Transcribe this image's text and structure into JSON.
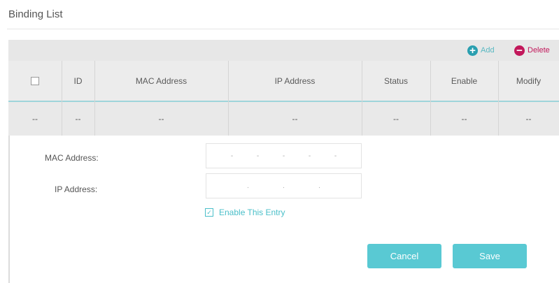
{
  "title": "Binding List",
  "toolbar": {
    "add_label": "Add",
    "delete_label": "Delete",
    "add_color": "#2a9fb0",
    "delete_color": "#c2185b",
    "add_icon": "plus-circle-icon",
    "delete_icon": "minus-circle-icon"
  },
  "table": {
    "headers": [
      "",
      "ID",
      "MAC Address",
      "IP Address",
      "Status",
      "Enable",
      "Modify"
    ],
    "rows": [
      [
        "--",
        "--",
        "--",
        "--",
        "--",
        "--",
        "--"
      ]
    ]
  },
  "form": {
    "mac_label": "MAC Address:",
    "ip_label": "IP Address:",
    "mac_separators": [
      "-",
      "-",
      "-",
      "-",
      "-"
    ],
    "ip_separators": [
      ".",
      ".",
      "."
    ],
    "enable_label": "Enable This Entry",
    "enable_checked": true
  },
  "buttons": {
    "cancel": "Cancel",
    "save": "Save"
  },
  "colors": {
    "accent": "#59c9d3",
    "header_bg": "#ececec",
    "row_bg": "#e9e9e9",
    "enable_text": "#4abfc9"
  }
}
